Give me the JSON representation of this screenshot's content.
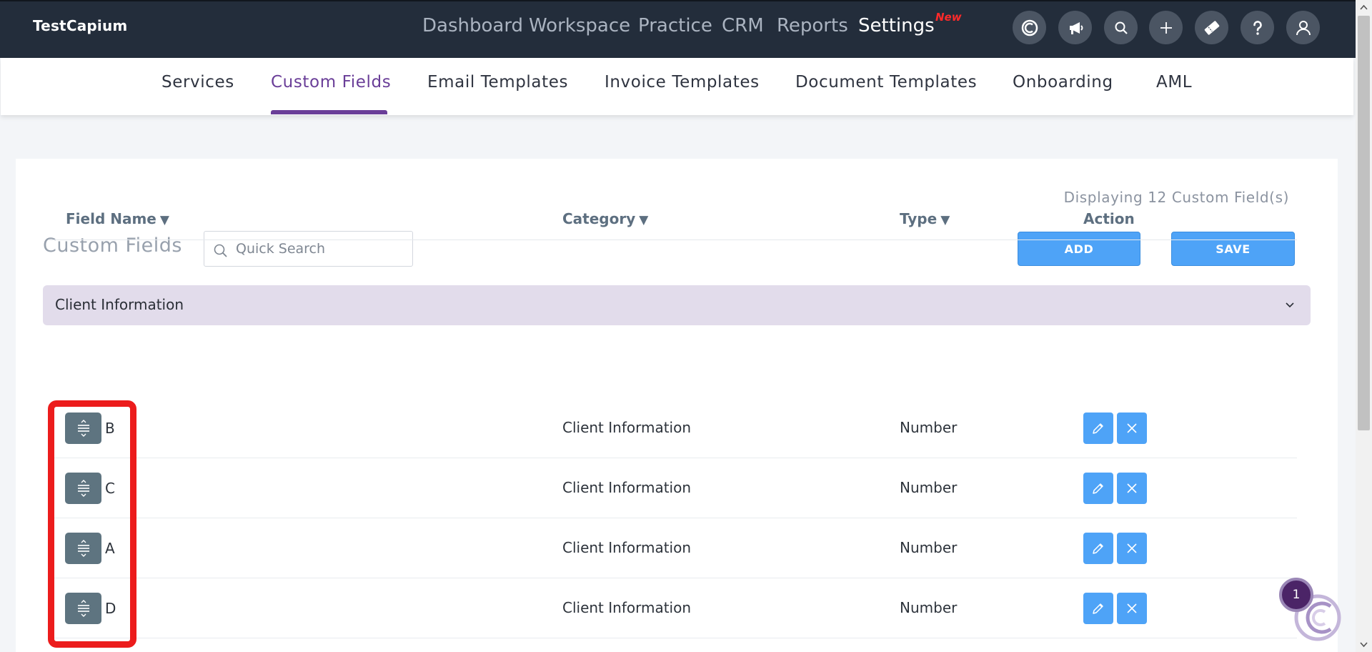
{
  "app": {
    "brand": "TestCapium"
  },
  "main_nav": {
    "items": [
      {
        "label": "Dashboard",
        "active": false
      },
      {
        "label": "Workspace",
        "active": false
      },
      {
        "label": "Practice",
        "active": false
      },
      {
        "label": "CRM",
        "active": false
      },
      {
        "label": "Reports",
        "active": false
      },
      {
        "label": "Settings",
        "active": true
      }
    ],
    "new_badge": "New"
  },
  "top_icons": [
    "capium-logo-icon",
    "megaphone-icon",
    "search-icon",
    "plus-icon",
    "ticket-icon",
    "question-icon",
    "user-icon"
  ],
  "sub_nav": {
    "items": [
      {
        "label": "Services",
        "active": false
      },
      {
        "label": "Custom Fields",
        "active": true
      },
      {
        "label": "Email Templates",
        "active": false
      },
      {
        "label": "Invoice Templates",
        "active": false
      },
      {
        "label": "Document Templates",
        "active": false
      },
      {
        "label": "Onboarding",
        "active": false
      },
      {
        "label": "AML",
        "active": false
      }
    ]
  },
  "page": {
    "count_text": "Displaying 12 Custom Field(s)",
    "title": "Custom Fields",
    "search_placeholder": "Quick Search",
    "add_label": "ADD",
    "save_label": "SAVE"
  },
  "accordion": {
    "label": "Client Information"
  },
  "table": {
    "headers": {
      "field_name": "Field Name",
      "category": "Category",
      "type": "Type",
      "action": "Action",
      "sort_glyph": "▼"
    },
    "rows": [
      {
        "field_name": "B",
        "category": "Client Information",
        "type": "Number"
      },
      {
        "field_name": "C",
        "category": "Client Information",
        "type": "Number"
      },
      {
        "field_name": "A",
        "category": "Client Information",
        "type": "Number"
      },
      {
        "field_name": "D",
        "category": "Client Information",
        "type": "Number"
      }
    ]
  },
  "chat": {
    "badge_count": "1"
  },
  "colors": {
    "topbar": "#232d3b",
    "accent_purple": "#6a3e98",
    "primary_blue": "#4ea3f7",
    "accordion_bg": "#e2dceb",
    "drag_handle": "#5e7480",
    "highlight_red": "#ec1c1c",
    "new_badge": "#ff2a2a"
  }
}
